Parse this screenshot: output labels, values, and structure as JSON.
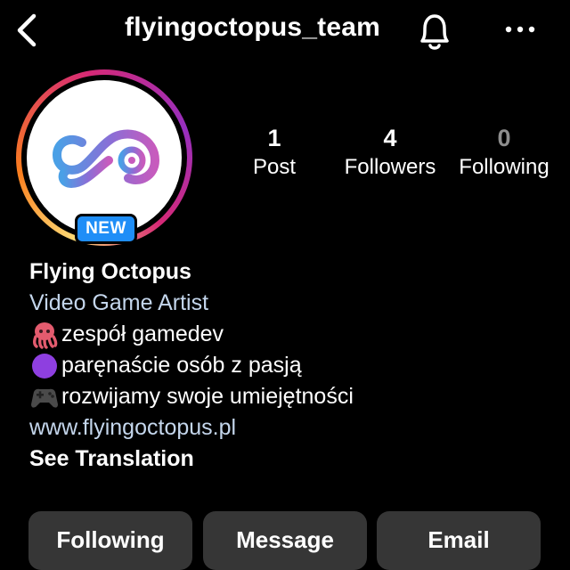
{
  "topbar": {
    "username": "flyingoctopus_team",
    "back_icon": "chevron-left-icon",
    "bell_icon": "bell-icon",
    "more_icon": "more-horizontal-icon"
  },
  "avatar": {
    "badge": "NEW",
    "ring_colors": [
      "#feda75",
      "#fa7e1e",
      "#d62976",
      "#962fbf"
    ],
    "logo_colors": [
      "#4aa0e6",
      "#8a6ed6",
      "#c75bbd"
    ]
  },
  "stats": {
    "posts_count": "1",
    "posts_label": "Post",
    "followers_count": "4",
    "followers_label": "Followers",
    "following_count": "0",
    "following_label": "Following"
  },
  "bio": {
    "name": "Flying Octopus",
    "category": "Video Game Artist",
    "lines": [
      {
        "emoji": "octopus-emoji",
        "text": "zespół gamedev"
      },
      {
        "emoji": "purple-circle-emoji",
        "text": "paręnaście osób z pasją"
      },
      {
        "emoji": "game-controller-emoji",
        "text": "rozwijamy swoje umiejętności"
      }
    ],
    "link": "www.flyingoctopus.pl",
    "see_translation": "See Translation"
  },
  "actions": {
    "following": "Following",
    "message": "Message",
    "email": "Email"
  },
  "colors": {
    "background": "#000000",
    "button": "#363636",
    "link": "#c4d6ec",
    "badge": "#1f8ef7"
  }
}
